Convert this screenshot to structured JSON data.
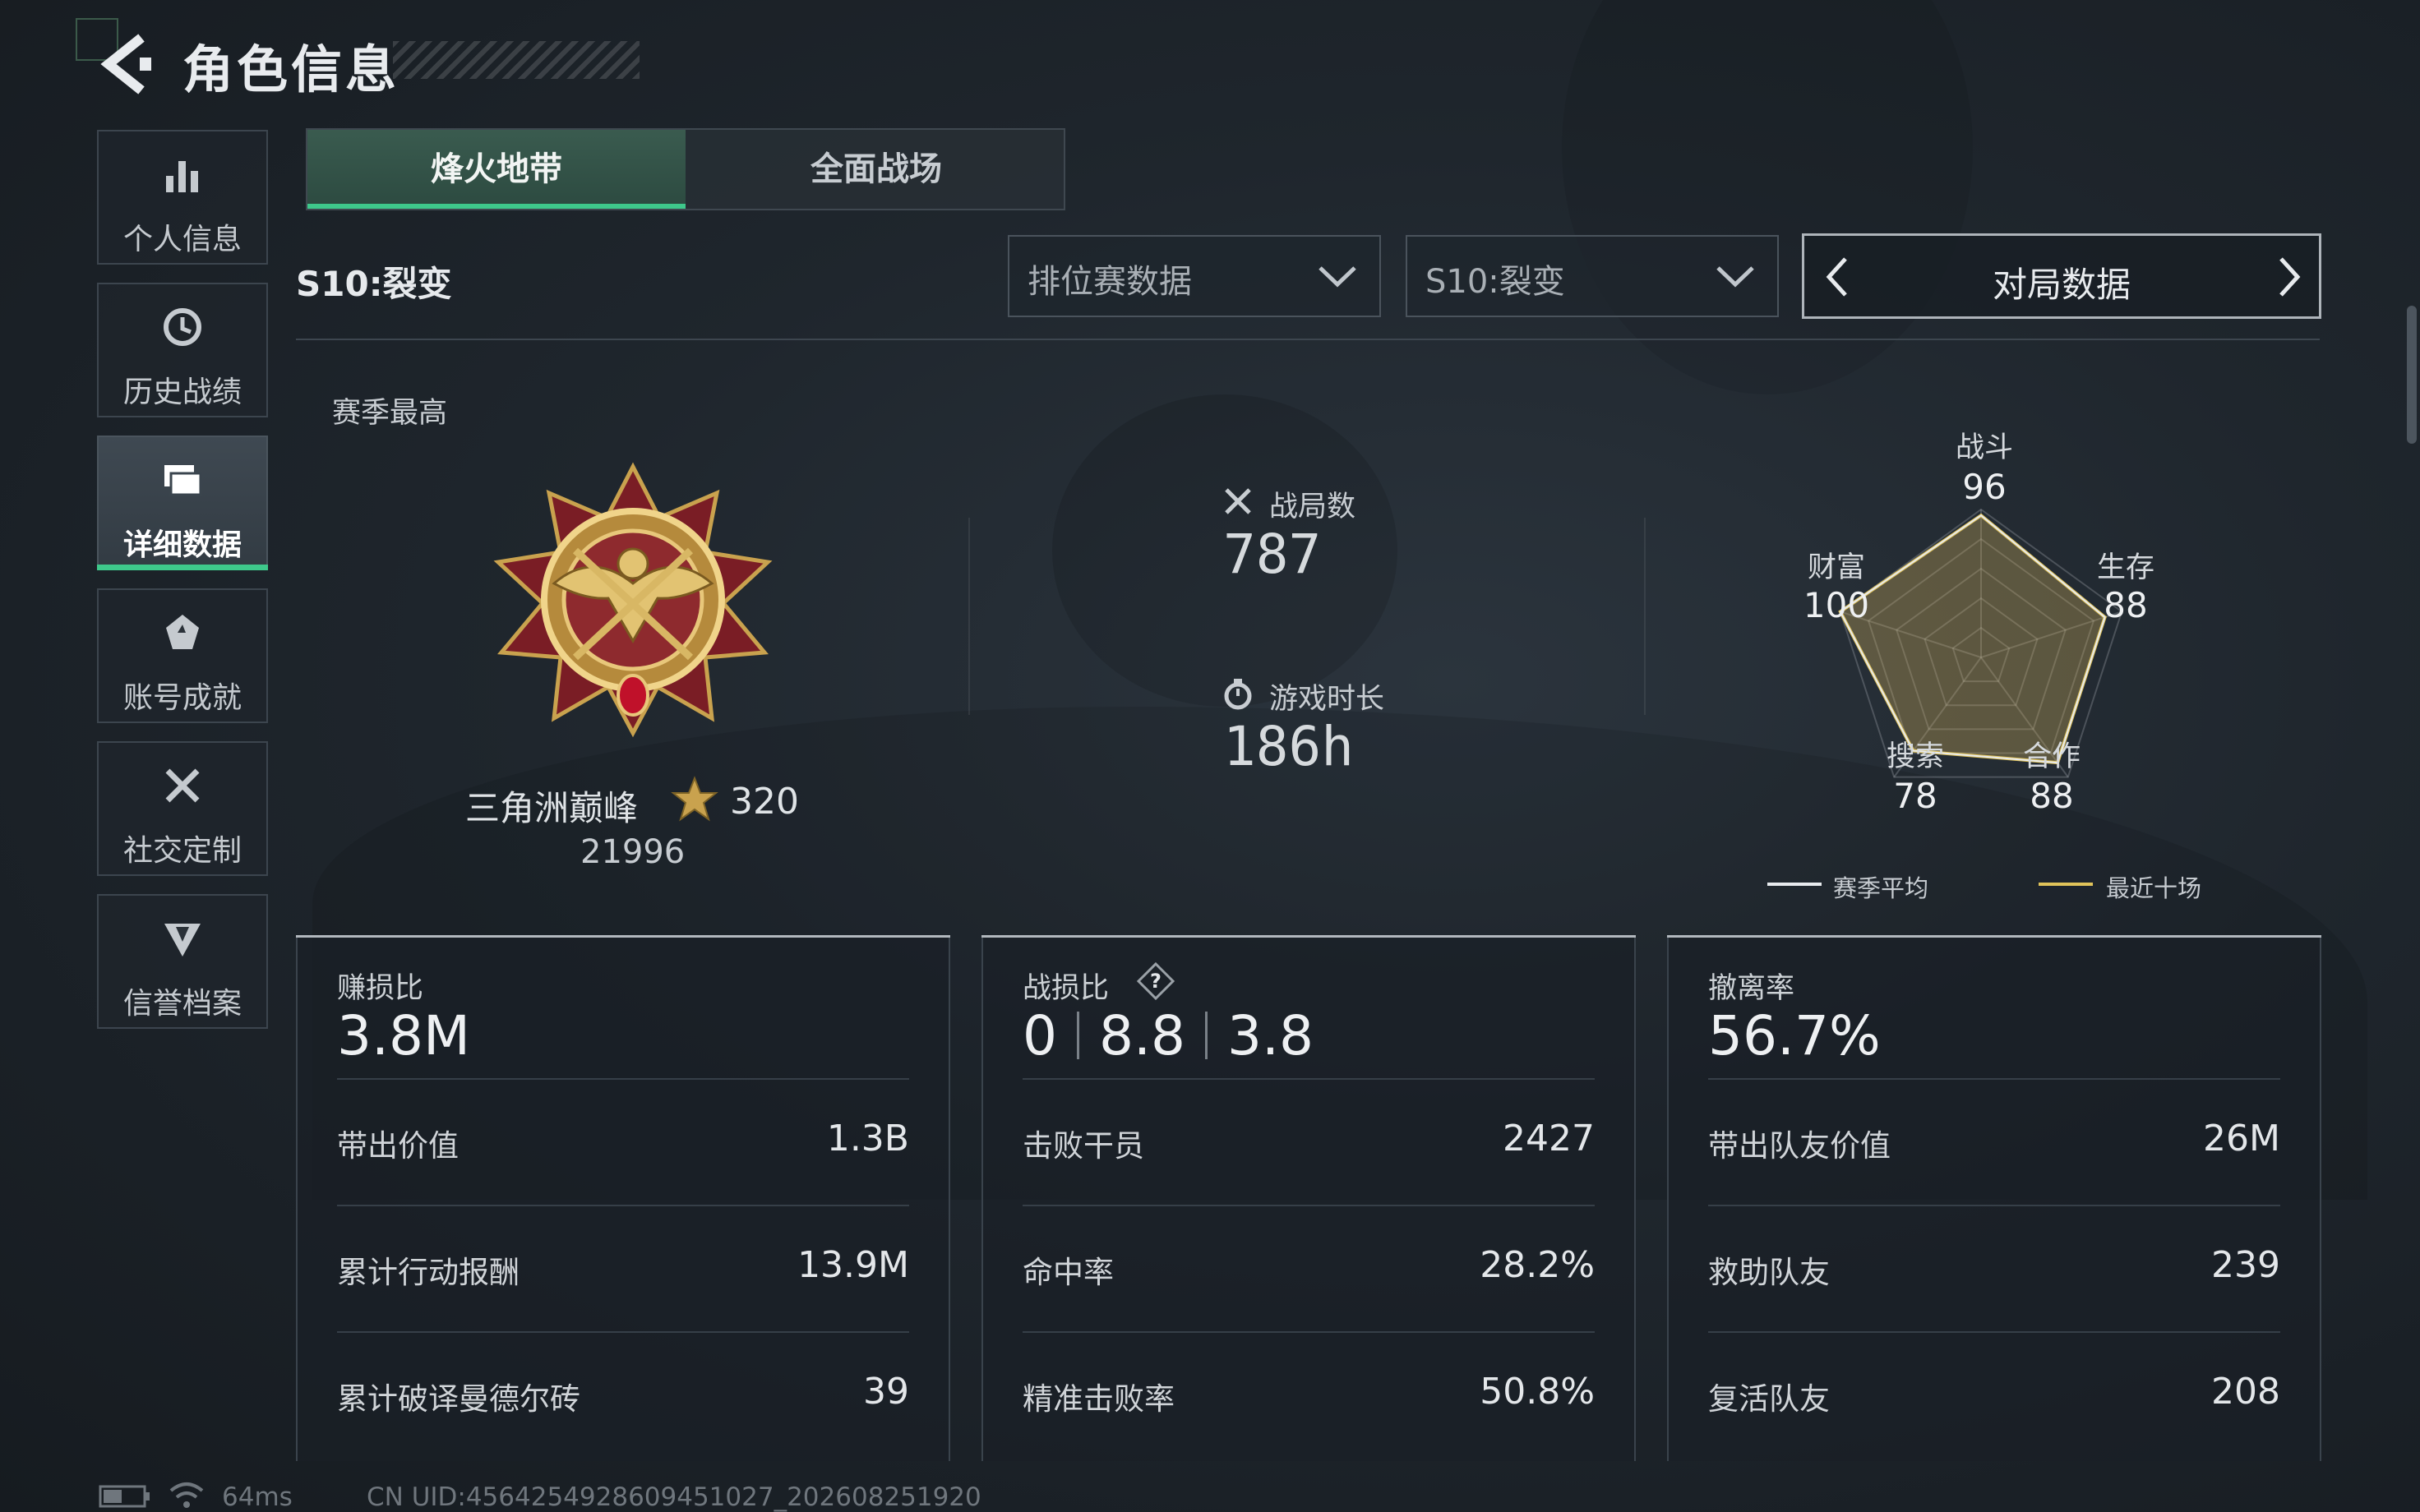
{
  "header": {
    "title": "角色信息"
  },
  "sidebar": {
    "items": [
      {
        "label": "个人信息"
      },
      {
        "label": "历史战绩"
      },
      {
        "label": "详细数据"
      },
      {
        "label": "账号成就"
      },
      {
        "label": "社交定制"
      },
      {
        "label": "信誉档案"
      }
    ],
    "active_index": 2
  },
  "tabs": [
    {
      "label": "烽火地带"
    },
    {
      "label": "全面战场"
    }
  ],
  "filters": {
    "season_label": "S10:裂变",
    "mode_dropdown": "排位赛数据",
    "season_dropdown": "S10:裂变",
    "view_pager": "对局数据"
  },
  "season_best": {
    "label": "赛季最高",
    "rank_name": "三角洲巅峰",
    "stars": "320",
    "score": "21996"
  },
  "summary": {
    "matches_label": "战局数",
    "matches": "787",
    "playtime_label": "游戏时长",
    "playtime": "186h"
  },
  "radar": {
    "axes": [
      {
        "label": "战斗",
        "value": "96"
      },
      {
        "label": "生存",
        "value": "88"
      },
      {
        "label": "合作",
        "value": "88"
      },
      {
        "label": "搜索",
        "value": "78"
      },
      {
        "label": "财富",
        "value": "100"
      }
    ],
    "legend": [
      {
        "label": "赛季平均",
        "color": "#e8ebee"
      },
      {
        "label": "最近十场",
        "color": "#e0c35a"
      }
    ]
  },
  "cards": [
    {
      "title": "赚损比",
      "headline": "3.8M",
      "rows": [
        {
          "k": "带出价值",
          "v": "1.3B"
        },
        {
          "k": "累计行动报酬",
          "v": "13.9M"
        },
        {
          "k": "累计破译曼德尔砖",
          "v": "39"
        }
      ]
    },
    {
      "title": "战损比",
      "kd": [
        "0",
        "8.8",
        "3.8"
      ],
      "rows": [
        {
          "k": "击败干员",
          "v": "2427"
        },
        {
          "k": "命中率",
          "v": "28.2%"
        },
        {
          "k": "精准击败率",
          "v": "50.8%"
        }
      ]
    },
    {
      "title": "撤离率",
      "headline": "56.7%",
      "rows": [
        {
          "k": "带出队友价值",
          "v": "26M"
        },
        {
          "k": "救助队友",
          "v": "239"
        },
        {
          "k": "复活队友",
          "v": "208"
        }
      ]
    }
  ],
  "footer": {
    "ping": "64ms",
    "uid": "CN UID:4564254928609451027_202608251920"
  },
  "colors": {
    "accent": "#3ec88b",
    "gold": "#e0c35a"
  }
}
